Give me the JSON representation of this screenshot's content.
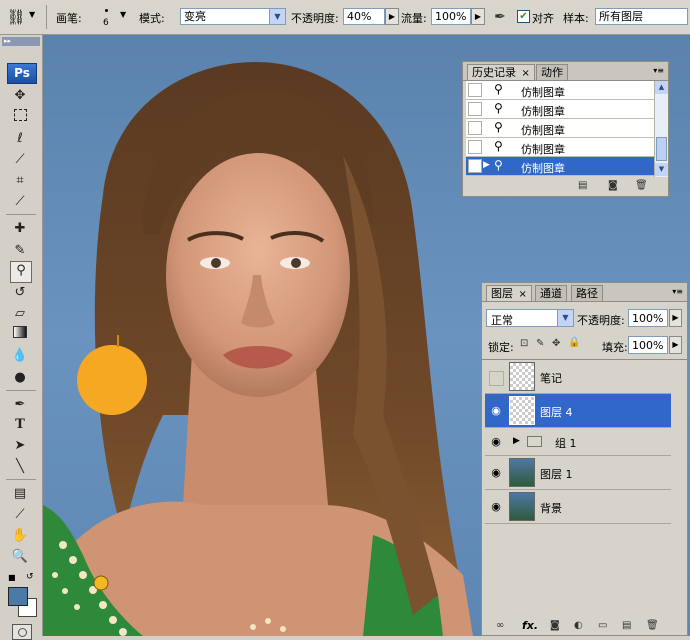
{
  "options_bar": {
    "brush_label": "画笔:",
    "brush_size": "6",
    "mode_label": "模式:",
    "mode_value": "变亮",
    "opacity_label": "不透明度:",
    "opacity_value": "40%",
    "flow_label": "流量:",
    "flow_value": "100%",
    "aligned_label": "对齐",
    "aligned_checked": true,
    "sample_label": "样本:",
    "sample_value": "所有图层"
  },
  "toolbar": {
    "ps_logo": "Ps",
    "tools": [
      "move-tool",
      "marquee-tool",
      "lasso-tool",
      "quick-select-tool",
      "crop-tool",
      "eyedropper-tool",
      "healing-tool",
      "brush-tool",
      "clone-stamp-tool",
      "history-brush-tool",
      "eraser-tool",
      "gradient-tool",
      "blur-tool",
      "dodge-tool",
      "pen-tool",
      "type-tool",
      "path-select-tool",
      "line-tool",
      "notes-tool",
      "eyedropper2-tool",
      "hand-tool",
      "zoom-tool"
    ],
    "type_glyph": "T",
    "foreground_color": "#4a7aa6",
    "background_color": "#ffffff"
  },
  "history_panel": {
    "tabs": [
      {
        "label": "历史记录",
        "active": true
      },
      {
        "label": "动作",
        "active": false
      }
    ],
    "close_glyph": "×",
    "items": [
      {
        "label": "仿制图章",
        "selected": false
      },
      {
        "label": "仿制图章",
        "selected": false
      },
      {
        "label": "仿制图章",
        "selected": false
      },
      {
        "label": "仿制图章",
        "selected": false
      },
      {
        "label": "仿制图章",
        "selected": true
      }
    ]
  },
  "layers_panel": {
    "tabs": [
      {
        "label": "图层",
        "active": true
      },
      {
        "label": "通道",
        "active": false
      },
      {
        "label": "路径",
        "active": false
      }
    ],
    "close_glyph": "×",
    "blend_mode": "正常",
    "opacity_label": "不透明度:",
    "opacity_value": "100%",
    "lock_label": "锁定:",
    "fill_label": "填充:",
    "fill_value": "100%",
    "fx_label": "fx.",
    "layers": [
      {
        "name": "笔记",
        "visible": false,
        "selected": false,
        "thumb": "transparent"
      },
      {
        "name": "图层 4",
        "visible": true,
        "selected": true,
        "thumb": "transparent"
      },
      {
        "name": "组 1",
        "visible": true,
        "selected": false,
        "thumb": "group"
      },
      {
        "name": "图层 1",
        "visible": true,
        "selected": false,
        "thumb": "photo"
      },
      {
        "name": "背景",
        "visible": true,
        "selected": false,
        "thumb": "photo"
      }
    ]
  },
  "colors": {
    "selection": "#3167c8",
    "canvas_bg": "#6a93bf",
    "panel_bg": "#d6d3cb",
    "earring": "#f7a823"
  }
}
